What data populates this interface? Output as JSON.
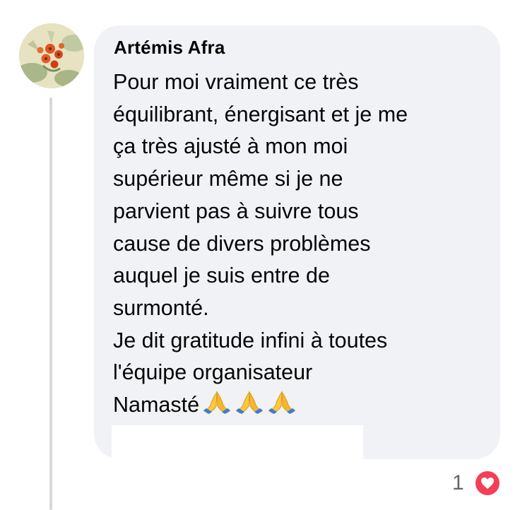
{
  "comment": {
    "author": "Artémis Afra",
    "lines": [
      "Pour moi vraiment ce très",
      "équilibrant, énergisant et je me",
      "ça très ajusté à mon moi",
      "supérieur même si je ne",
      "parvient pas à suivre tous",
      "cause de divers problèmes",
      "auquel je suis entre de",
      "surmonté.",
      "Je dit gratitude infini à toutes",
      "l'équipe organisateur",
      "Namasté"
    ],
    "emoji": [
      "folded-hands",
      "folded-hands",
      "folded-hands"
    ]
  },
  "reactions": {
    "count": "1",
    "type": "love",
    "color": "#f33e58"
  },
  "colors": {
    "bubble": "#f0f2f5",
    "text": "#050505",
    "muted": "#65676b"
  }
}
